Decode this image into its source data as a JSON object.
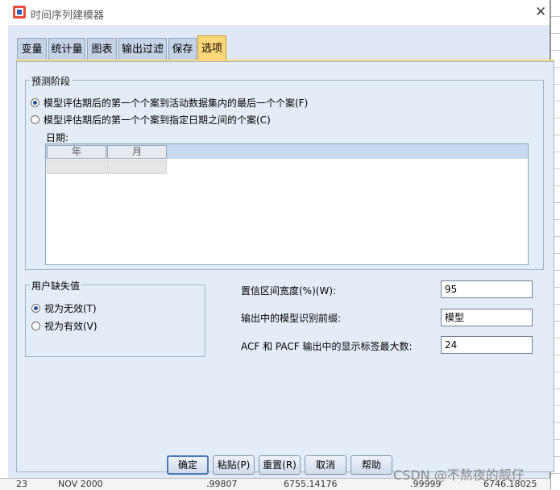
{
  "window": {
    "title": "时间序列建模器",
    "close_glyph": "✕"
  },
  "tabs": [
    {
      "label": "变量"
    },
    {
      "label": "统计量"
    },
    {
      "label": "图表"
    },
    {
      "label": "输出过滤"
    },
    {
      "label": "保存"
    },
    {
      "label": "选项",
      "active": true
    }
  ],
  "forecast_period": {
    "legend": "预测阶段",
    "option_first": "模型评估期后的第一个个案到活动数据集内的最后一个个案(F)",
    "option_second": "模型评估期后的第一个个案到指定日期之间的个案(C)",
    "selected": "option_first",
    "date_label": "日期:",
    "date_columns": [
      "年",
      "月"
    ]
  },
  "user_missing": {
    "legend": "用户缺失值",
    "option_invalid": "视为无效(T)",
    "option_valid": "视为有效(V)",
    "selected": "option_invalid"
  },
  "settings": {
    "ci_width_label": "置信区间宽度(%)(W):",
    "ci_width_value": "95",
    "model_prefix_label": "输出中的模型识别前缀:",
    "model_prefix_value": "模型",
    "max_lags_label": "ACF 和 PACF 输出中的显示标签最大数:",
    "max_lags_value": "24"
  },
  "buttons": {
    "ok": "确定",
    "paste": "粘贴(P)",
    "reset": "重置(R)",
    "cancel": "取消",
    "help": "帮助"
  },
  "background_row": {
    "row_num": "23",
    "date": "NOV 2000",
    "v1": ".99807",
    "v2": "6755.14176",
    "v3": ".99999",
    "v4": "6746.18025"
  },
  "watermark": "CSDN @不熬夜的靓仔",
  "colors": {
    "active_tab": "#ffd779",
    "panel": "#e4edf7",
    "tab": "#c6d3e6"
  }
}
